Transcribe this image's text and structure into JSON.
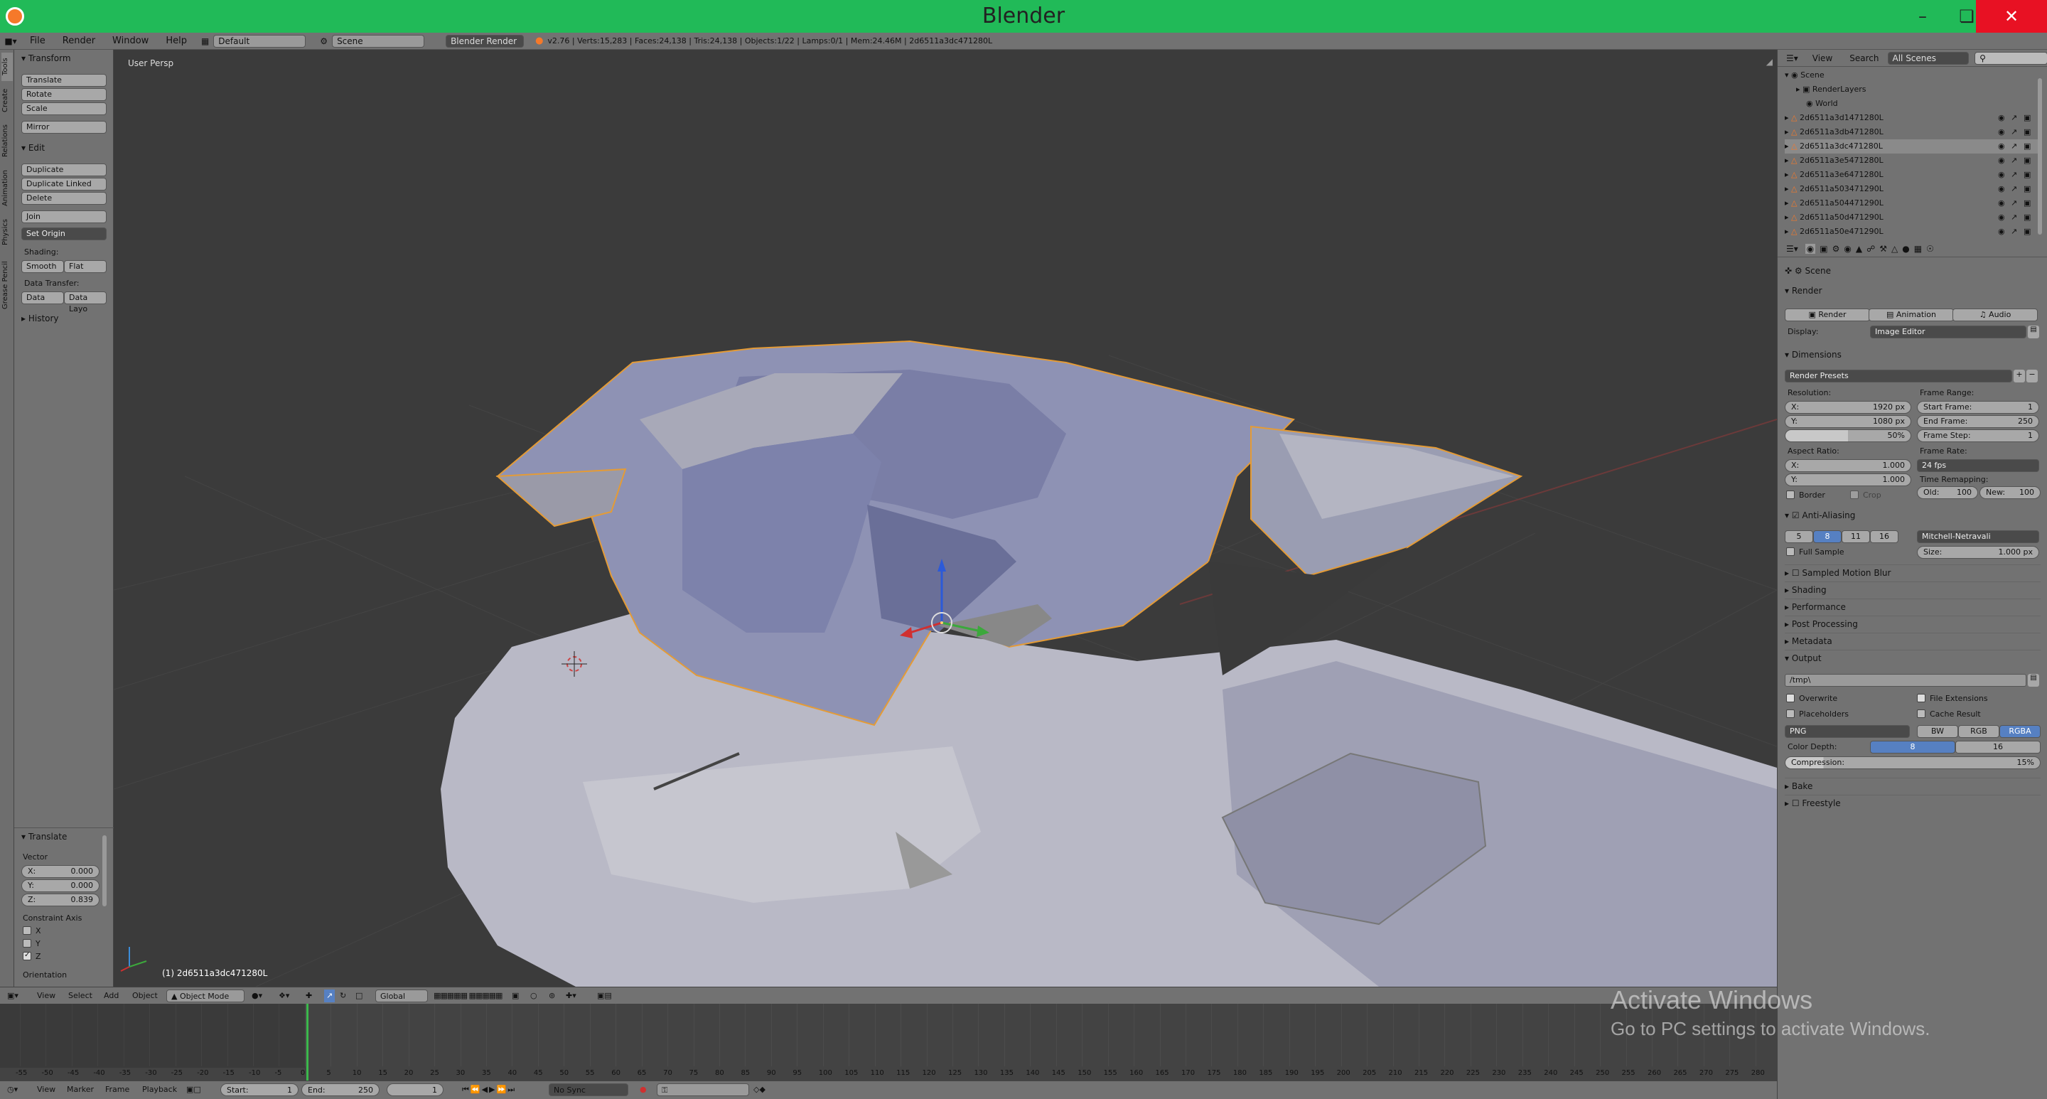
{
  "window": {
    "title": "Blender",
    "min_icon": "minimize-icon",
    "max_icon": "maximize-icon",
    "close_icon": "close-icon"
  },
  "infobar": {
    "menus": [
      "File",
      "Render",
      "Window",
      "Help"
    ],
    "layout": "Default",
    "scene": "Scene",
    "engine": "Blender Render",
    "stats": "v2.76 | Verts:15,283 | Faces:24,138 | Tris:24,138 | Objects:1/22 | Lamps:0/1 | Mem:24.46M | 2d6511a3dc471280L"
  },
  "toolshelf": {
    "tabs": [
      "Tools",
      "Create",
      "Relations",
      "Animation",
      "Physics",
      "Grease Pencil"
    ],
    "transform_title": "Transform",
    "translate": "Translate",
    "rotate": "Rotate",
    "scale": "Scale",
    "mirror": "Mirror",
    "edit_title": "Edit",
    "duplicate": "Duplicate",
    "duplicate_linked": "Duplicate Linked",
    "delete": "Delete",
    "join": "Join",
    "set_origin": "Set Origin",
    "shading_label": "Shading:",
    "smooth": "Smooth",
    "flat": "Flat",
    "data_transfer_label": "Data Transfer:",
    "data": "Data",
    "data_layo": "Data Layo",
    "history": "History"
  },
  "operator": {
    "title": "Translate",
    "vector_label": "Vector",
    "x_label": "X:",
    "x": "0.000",
    "y_label": "Y:",
    "y": "0.000",
    "z_label": "Z:",
    "z": "0.839",
    "constraint_label": "Constraint Axis",
    "cx": "X",
    "cy": "Y",
    "cz": "Z",
    "orientation": "Orientation"
  },
  "viewport": {
    "view_name": "User Persp",
    "object_label": "(1) 2d6511a3dc471280L"
  },
  "outliner": {
    "view": "View",
    "search": "Search",
    "filter": "All Scenes",
    "scene": "Scene",
    "render_layers": "RenderLayers",
    "world": "World",
    "objects": [
      "2d6511a3d1471280L",
      "2d6511a3db471280L",
      "2d6511a3dc471280L",
      "2d6511a3e5471280L",
      "2d6511a3e6471280L",
      "2d6511a503471290L",
      "2d6511a504471290L",
      "2d6511a50d471290L",
      "2d6511a50e471290L"
    ]
  },
  "properties": {
    "breadcrumb": "Scene",
    "render_section": "Render",
    "render_btn": "Render",
    "animation_btn": "Animation",
    "audio_btn": "Audio",
    "display_label": "Display:",
    "display_value": "Image Editor",
    "dimensions_section": "Dimensions",
    "render_presets": "Render Presets",
    "resolution_label": "Resolution:",
    "res_x_label": "X:",
    "res_x": "1920 px",
    "res_y_label": "Y:",
    "res_y": "1080 px",
    "res_pct": "50%",
    "frame_range_label": "Frame Range:",
    "start_label": "Start Frame:",
    "start": "1",
    "end_label": "End Frame:",
    "end": "250",
    "step_label": "Frame Step:",
    "step": "1",
    "aspect_label": "Aspect Ratio:",
    "asp_x_label": "X:",
    "asp_x": "1.000",
    "asp_y_label": "Y:",
    "asp_y": "1.000",
    "frame_rate_label": "Frame Rate:",
    "fps": "24 fps",
    "time_remap_label": "Time Remapping:",
    "old_label": "Old:",
    "old": "100",
    "new_label": "New:",
    "new": "100",
    "border": "Border",
    "crop": "Crop",
    "aa_section": "Anti-Aliasing",
    "aa_samples": [
      "5",
      "8",
      "11",
      "16"
    ],
    "aa_filter": "Mitchell-Netravali",
    "full_sample": "Full Sample",
    "size_label": "Size:",
    "size": "1.000 px",
    "sampled_motion_blur": "Sampled Motion Blur",
    "shading": "Shading",
    "performance": "Performance",
    "post_processing": "Post Processing",
    "metadata": "Metadata",
    "output_section": "Output",
    "output_path": "/tmp\\",
    "overwrite": "Overwrite",
    "file_extensions": "File Extensions",
    "placeholders": "Placeholders",
    "cache_result": "Cache Result",
    "format": "PNG",
    "bw": "BW",
    "rgb": "RGB",
    "rgba": "RGBA",
    "color_depth_label": "Color Depth:",
    "depth8": "8",
    "depth16": "16",
    "compression_label": "Compression:",
    "compression": "15%",
    "bake": "Bake",
    "freestyle": "Freestyle"
  },
  "header3d": {
    "view": "View",
    "select": "Select",
    "add": "Add",
    "object": "Object",
    "mode": "Object Mode",
    "orientation": "Global"
  },
  "timeline": {
    "ticks": [
      "-55",
      "-50",
      "-45",
      "-40",
      "-35",
      "-30",
      "-25",
      "-20",
      "-15",
      "-10",
      "-5",
      "0",
      "5",
      "10",
      "15",
      "20",
      "25",
      "30",
      "35",
      "40",
      "45",
      "50",
      "55",
      "60",
      "65",
      "70",
      "75",
      "80",
      "85",
      "90",
      "95",
      "100",
      "105",
      "110",
      "115",
      "120",
      "125",
      "130",
      "135",
      "140",
      "145",
      "150",
      "155",
      "160",
      "165",
      "170",
      "175",
      "180",
      "185",
      "190",
      "195",
      "200",
      "205",
      "210",
      "215",
      "220",
      "225",
      "230",
      "235",
      "240",
      "245",
      "250",
      "255",
      "260",
      "265",
      "270",
      "275",
      "280"
    ],
    "view": "View",
    "marker": "Marker",
    "frame": "Frame",
    "playback": "Playback",
    "start_label": "Start:",
    "start": "1",
    "end_label": "End:",
    "end": "250",
    "current": "1",
    "sync": "No Sync"
  },
  "watermark": {
    "line1": "Activate Windows",
    "line2": "Go to PC settings to activate Windows."
  }
}
